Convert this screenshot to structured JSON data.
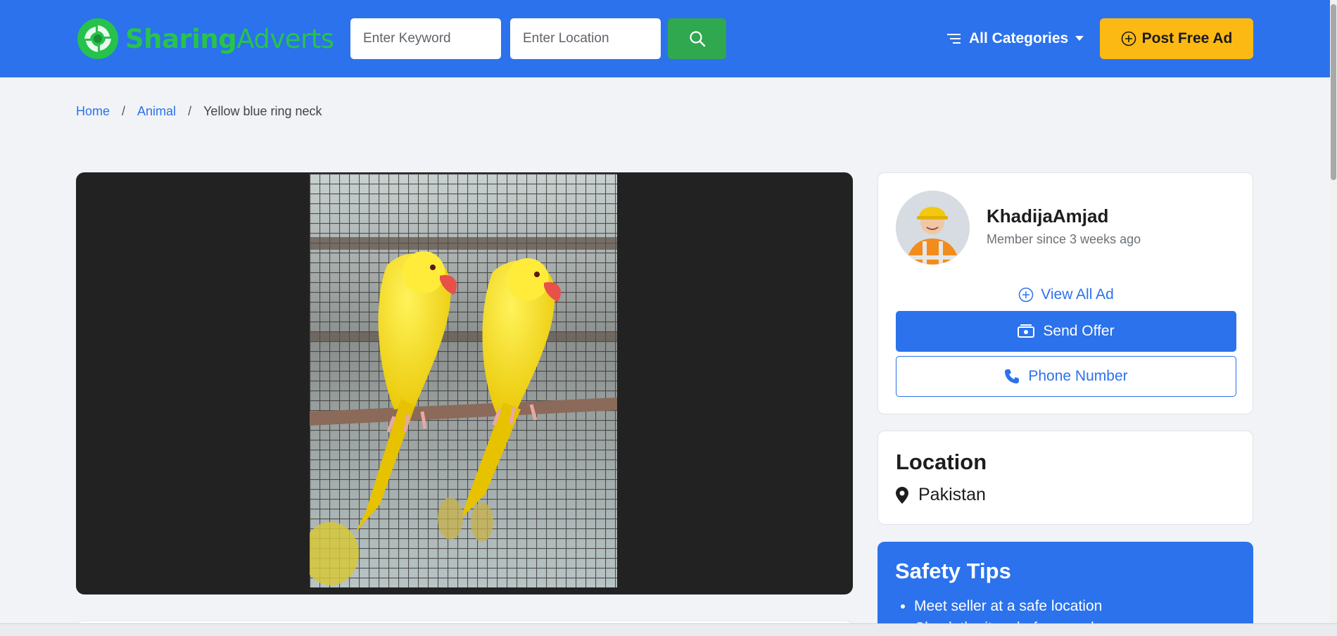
{
  "header": {
    "logo_bold": "Sharing",
    "logo_light": "Adverts",
    "keyword_placeholder": "Enter Keyword",
    "location_placeholder": "Enter Location",
    "categories_label": "All Categories",
    "post_ad_label": "Post Free Ad",
    "brand_color": "#2b72ec",
    "accent_color": "#fdb913",
    "logo_color": "#27c34c"
  },
  "breadcrumb": {
    "home": "Home",
    "category": "Animal",
    "current": "Yellow blue ring neck",
    "separator": "/"
  },
  "seller": {
    "name": "KhadijaAmjad",
    "member_since": "Member since 3 weeks ago",
    "view_all_label": "View All Ad",
    "send_offer_label": "Send Offer",
    "phone_label": "Phone Number"
  },
  "location": {
    "title": "Location",
    "value": "Pakistan"
  },
  "safety": {
    "title": "Safety Tips",
    "tips": [
      "Meet seller at a safe location",
      "Check the item before you buy"
    ]
  },
  "icons": {
    "search": "search-icon",
    "menu": "menu-lines-icon",
    "caret": "caret-down-icon",
    "plus": "plus-circle-icon",
    "offer": "money-icon",
    "phone": "phone-icon",
    "pin": "map-pin-icon"
  }
}
